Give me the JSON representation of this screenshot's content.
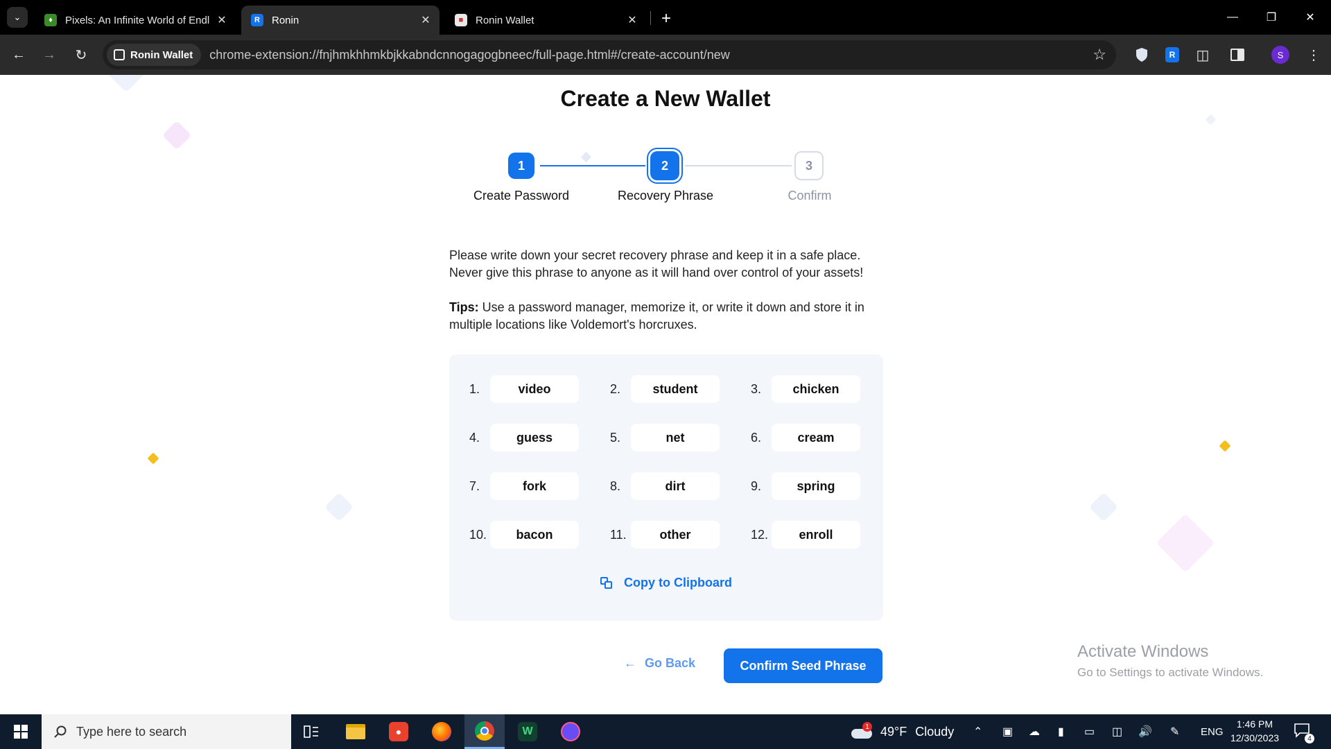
{
  "browser": {
    "tabs": [
      {
        "title": "Pixels: An Infinite World of Endl",
        "active": false
      },
      {
        "title": "Ronin",
        "active": true
      },
      {
        "title": "Ronin Wallet",
        "active": false
      }
    ],
    "site_chip": "Ronin Wallet",
    "url": "chrome-extension://fnjhmkhhmkbjkkabndcnnogagogbneec/full-page.html#/create-account/new",
    "profile_initial": "S"
  },
  "page": {
    "title": "Create a New Wallet",
    "steps": [
      {
        "number": "1",
        "label": "Create Password",
        "state": "done"
      },
      {
        "number": "2",
        "label": "Recovery Phrase",
        "state": "current"
      },
      {
        "number": "3",
        "label": "Confirm",
        "state": "todo"
      }
    ],
    "description_line1": "Please write down your secret recovery phrase and keep it in a safe place.",
    "description_line2": "Never give this phrase to anyone as it will hand over control of your assets!",
    "tips_label": "Tips:",
    "tips_text_line1": " Use a password manager, memorize it, or write it down and store it in",
    "tips_text_line2": "multiple locations like Voldemort's horcruxes.",
    "phrase_words": [
      {
        "num": "1.",
        "word": "video"
      },
      {
        "num": "2.",
        "word": "student"
      },
      {
        "num": "3.",
        "word": "chicken"
      },
      {
        "num": "4.",
        "word": "guess"
      },
      {
        "num": "5.",
        "word": "net"
      },
      {
        "num": "6.",
        "word": "cream"
      },
      {
        "num": "7.",
        "word": "fork"
      },
      {
        "num": "8.",
        "word": "dirt"
      },
      {
        "num": "9.",
        "word": "spring"
      },
      {
        "num": "10.",
        "word": "bacon"
      },
      {
        "num": "11.",
        "word": "other"
      },
      {
        "num": "12.",
        "word": "enroll"
      }
    ],
    "copy_label": "Copy to Clipboard",
    "go_back_label": "Go Back",
    "confirm_label": "Confirm Seed Phrase"
  },
  "watermark": {
    "line1": "Activate Windows",
    "line2": "Go to Settings to activate Windows."
  },
  "taskbar": {
    "search_placeholder": "Type here to search",
    "weather_temp": "49°F",
    "weather_text": "Cloudy",
    "weather_alert": "1",
    "language": "ENG",
    "time": "1:46 PM",
    "date": "12/30/2023",
    "notification_count": "4"
  },
  "colors": {
    "accent": "#1273ea",
    "muted": "#8a94a6",
    "phrase_bg": "#f3f6fb"
  }
}
